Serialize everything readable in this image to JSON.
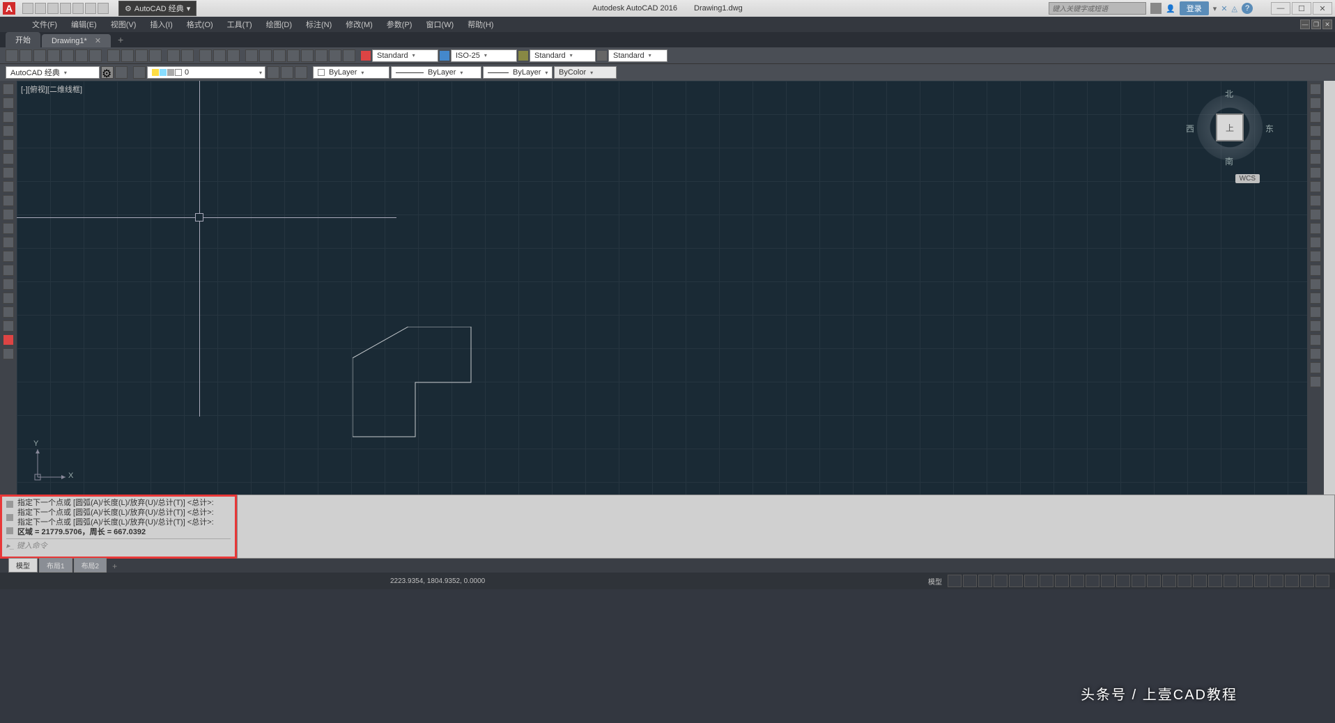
{
  "titlebar": {
    "app_letter": "A",
    "workspace_label": "AutoCAD 经典",
    "app_title": "Autodesk AutoCAD 2016",
    "doc_name": "Drawing1.dwg",
    "search_placeholder": "键入关键字或短语",
    "login_label": "登录"
  },
  "menubar": {
    "items": [
      "文件(F)",
      "编辑(E)",
      "视图(V)",
      "插入(I)",
      "格式(O)",
      "工具(T)",
      "绘图(D)",
      "标注(N)",
      "修改(M)",
      "参数(P)",
      "窗口(W)",
      "帮助(H)"
    ]
  },
  "doctabs": {
    "start_label": "开始",
    "active_doc": "Drawing1*"
  },
  "styles_row": {
    "text_style": "Standard",
    "dim_style": "ISO-25",
    "table_style": "Standard",
    "mleader_style": "Standard"
  },
  "properties_row": {
    "workspace": "AutoCAD 经典",
    "layer": "0",
    "color": "ByLayer",
    "linetype": "ByLayer",
    "lineweight": "ByLayer",
    "plot_style": "ByColor"
  },
  "viewport": {
    "label": "[-][俯视][二维线框]"
  },
  "viewcube": {
    "north": "北",
    "south": "南",
    "east": "东",
    "west": "西",
    "top": "上",
    "wcs": "WCS"
  },
  "ucs": {
    "x": "X",
    "y": "Y"
  },
  "command": {
    "lines": [
      "指定下一个点或 [圆弧(A)/长度(L)/放弃(U)/总计(T)] <总计>:",
      "指定下一个点或 [圆弧(A)/长度(L)/放弃(U)/总计(T)] <总计>:",
      "指定下一个点或 [圆弧(A)/长度(L)/放弃(U)/总计(T)] <总计>:",
      "区域 = 21779.5706，周长 = 667.0392"
    ],
    "prompt": "▸_ 键入命令"
  },
  "layout_tabs": {
    "model": "模型",
    "layout1": "布局1",
    "layout2": "布局2"
  },
  "statusbar": {
    "coords": "2223.9354, 1804.9352, 0.0000",
    "model_label": "模型"
  },
  "watermark": "头条号 / 上壹CAD教程"
}
